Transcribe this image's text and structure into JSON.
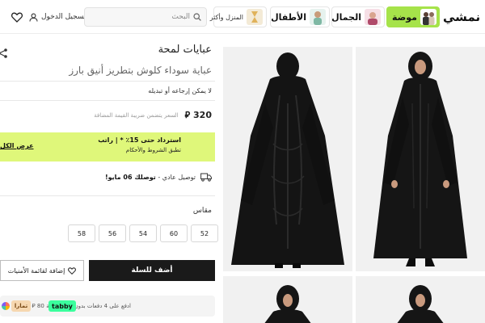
{
  "header": {
    "logo": "نمشي",
    "categories": {
      "fashion": "موضة",
      "beauty": "الجمال",
      "kids": "الأطفال",
      "home": "المنزل وأكثر"
    },
    "search_placeholder": "البحث",
    "login": "تسجيل الدخول"
  },
  "product": {
    "title": "عبايات لمحة",
    "subtitle": "عباية سوداء كلوش بتطريز أنيق بارز",
    "return_note": "لا يمكن إرجاعه أو تبديله",
    "price": "320",
    "currency_symbol": "⃁",
    "vat_note": "السعر يتضمن ضريبة القيمة المضافة",
    "cashback_line1": "استرداد حتى 15٪ * | راتب",
    "cashback_line2": "تطبق الشروط والأحكام",
    "cashback_link": "عرض الكل",
    "delivery_prefix": "توصيل عادي - ",
    "delivery_bold": "توصلك 06 مايو!",
    "size_label": "مقاس",
    "sizes": [
      "52",
      "60",
      "54",
      "56",
      "58"
    ],
    "add_to_cart": "أضف للسلة",
    "add_to_wishlist": "إضافة لقائمة الأمنيات",
    "installment_text": "ادفع على 4 دفعات بدون فوائد بقيمة 80 ⃁",
    "tabby_label": "tabby",
    "tamara_label": "تمارا"
  },
  "colors": {
    "fashion_accent": "#a6e34a",
    "cashback_bg": "#dff77a",
    "button_dark": "#1a1a1a",
    "tabby_green": "#3bff9d"
  },
  "icons": [
    "heart-icon",
    "user-icon",
    "search-icon",
    "share-icon",
    "truck-icon",
    "heart-outline-icon"
  ]
}
